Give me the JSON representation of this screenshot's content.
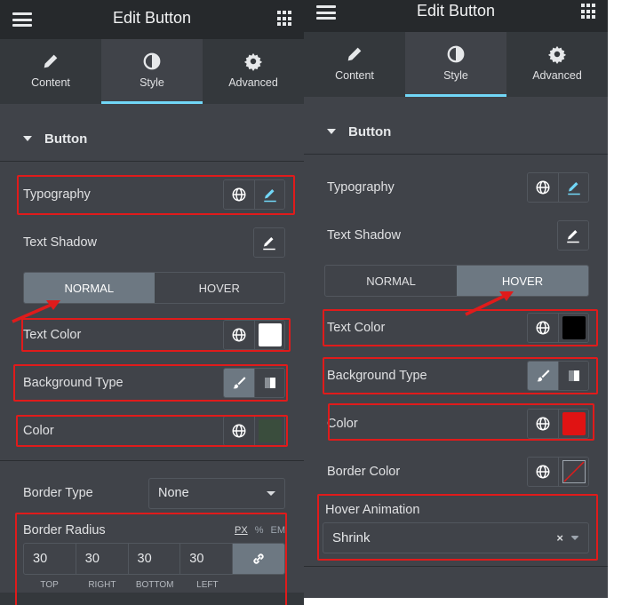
{
  "left": {
    "header": {
      "title": "Edit Button"
    },
    "tabs": [
      {
        "label": "Content",
        "icon": "pencil-icon",
        "active": false
      },
      {
        "label": "Style",
        "icon": "contrast-icon",
        "active": true
      },
      {
        "label": "Advanced",
        "icon": "gear-icon",
        "active": false
      }
    ],
    "section": "Button",
    "typography": "Typography",
    "text_shadow": "Text Shadow",
    "state_tabs": {
      "normal": "NORMAL",
      "hover": "HOVER",
      "active": "normal"
    },
    "text_color": {
      "label": "Text Color",
      "value": "#ffffff"
    },
    "background_type": "Background Type",
    "color": {
      "label": "Color",
      "value": "#3a4d3d"
    },
    "border_type": {
      "label": "Border Type",
      "value": "None"
    },
    "border_radius": {
      "label": "Border Radius",
      "units": [
        "PX",
        "%",
        "EM"
      ],
      "values": [
        "30",
        "30",
        "30",
        "30"
      ],
      "sides": [
        "TOP",
        "RIGHT",
        "BOTTOM",
        "LEFT"
      ]
    }
  },
  "right": {
    "header": {
      "title": "Edit Button"
    },
    "tabs": [
      {
        "label": "Content",
        "icon": "pencil-icon",
        "active": false
      },
      {
        "label": "Style",
        "icon": "contrast-icon",
        "active": true
      },
      {
        "label": "Advanced",
        "icon": "gear-icon",
        "active": false
      }
    ],
    "section": "Button",
    "typography": "Typography",
    "text_shadow": "Text Shadow",
    "state_tabs": {
      "normal": "NORMAL",
      "hover": "HOVER",
      "active": "hover"
    },
    "text_color": {
      "label": "Text Color",
      "value": "#000000"
    },
    "background_type": "Background Type",
    "color": {
      "label": "Color",
      "value": "#e01313"
    },
    "border_color": {
      "label": "Border Color",
      "value": "none"
    },
    "hover_animation": {
      "label": "Hover Animation",
      "value": "Shrink"
    }
  },
  "colors": {
    "accent": "#71d7f7",
    "annotation": "#e01b1b",
    "panel": "#404349"
  }
}
